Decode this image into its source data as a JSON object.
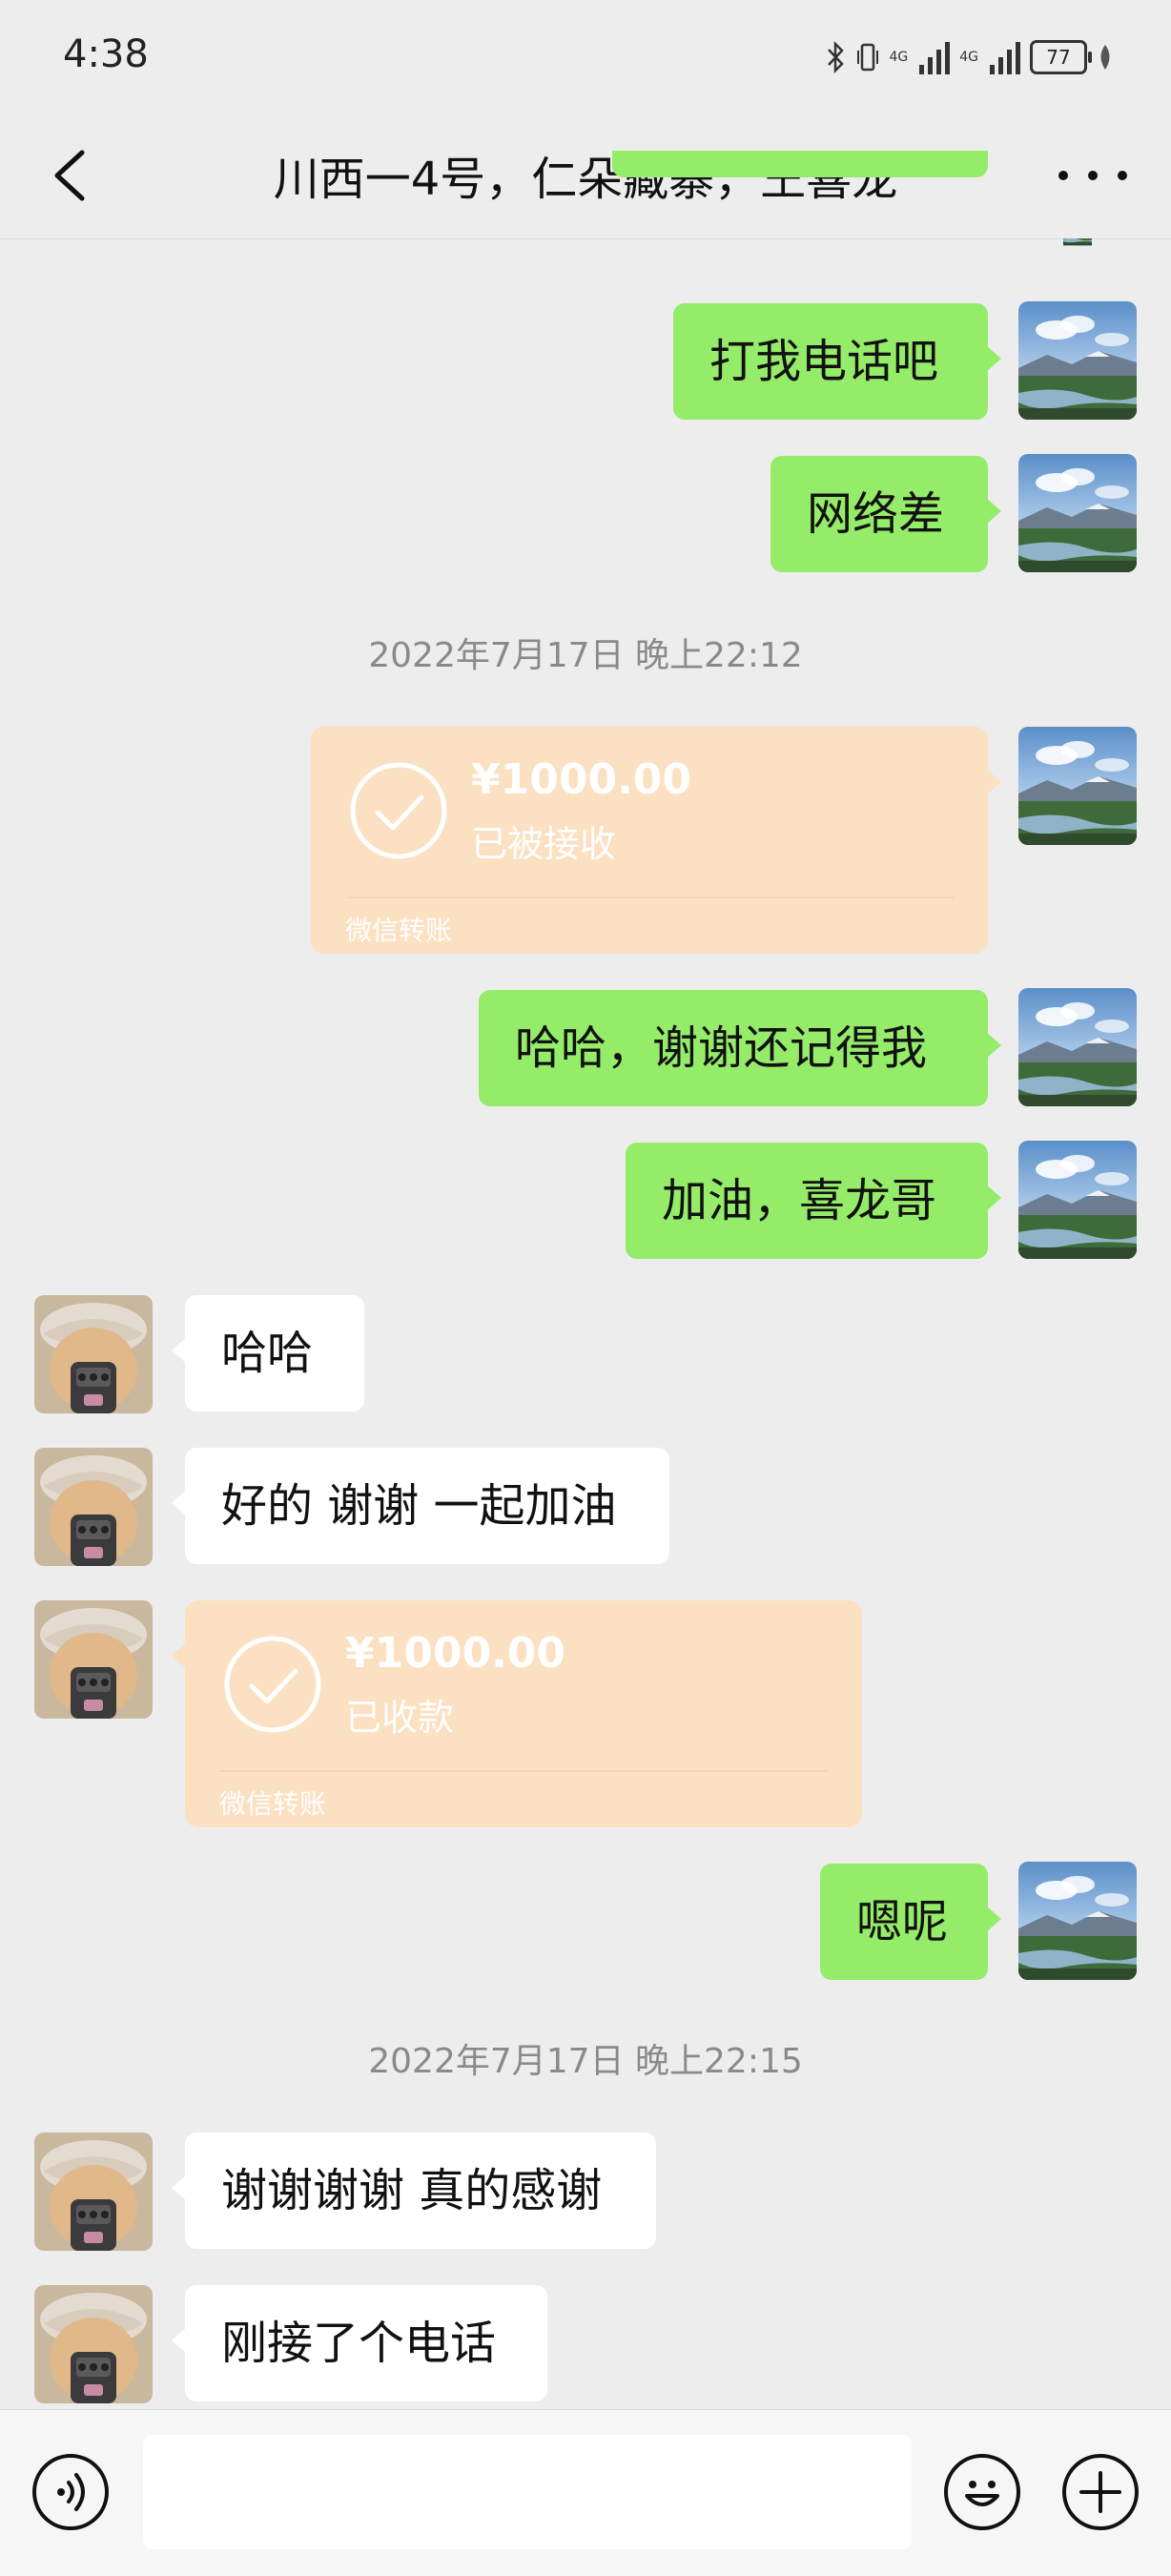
{
  "status_bar": {
    "time": "4:38",
    "network_1": "4G",
    "network_2": "4G",
    "battery": "77"
  },
  "header": {
    "title": "川西一4号，仁朵藏寨，王喜龙"
  },
  "messages": {
    "m1": "打我电话吧",
    "m2": "网络差",
    "ts1": "2022年7月17日 晚上22:12",
    "t1": {
      "amount": "¥1000.00",
      "status": "已被接收",
      "label": "微信转账"
    },
    "m3": "哈哈，谢谢还记得我",
    "m4": "加油，喜龙哥",
    "m5": "哈哈",
    "m6": "好的 谢谢 一起加油",
    "t2": {
      "amount": "¥1000.00",
      "status": "已收款",
      "label": "微信转账"
    },
    "m7": "嗯呢",
    "ts2": "2022年7月17日 晚上22:15",
    "m8": "谢谢谢谢 真的感谢",
    "m9": "刚接了个电话"
  },
  "input": {
    "placeholder": ""
  },
  "colors": {
    "green_bubble": "#95ec69",
    "transfer_card": "#fbe0c2",
    "background": "#ededed"
  },
  "icons": [
    "back-icon",
    "more-icon",
    "voice-icon",
    "emoji-icon",
    "plus-icon",
    "check-icon"
  ]
}
